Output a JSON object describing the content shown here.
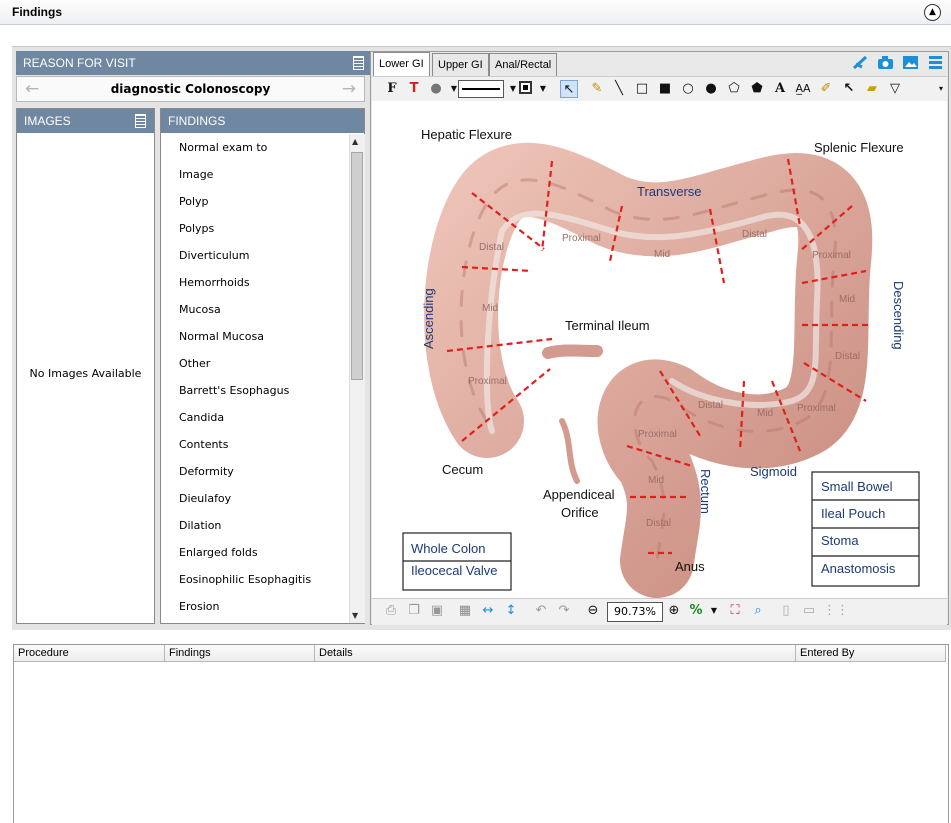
{
  "window": {
    "title": "Findings"
  },
  "reason_for_visit": {
    "header": "REASON FOR VISIT",
    "value": "diagnostic Colonoscopy"
  },
  "images": {
    "header": "IMAGES",
    "empty_text": "No Images Available"
  },
  "findings": {
    "header": "FINDINGS",
    "items": [
      "Normal exam to",
      "Image",
      "Polyp",
      "Polyps",
      "Diverticulum",
      "Hemorrhoids",
      "Mucosa",
      "Normal Mucosa",
      "Other",
      "Barrett's Esophagus",
      "Candida",
      "Contents",
      "Deformity",
      "Dieulafoy",
      "Dilation",
      "Enlarged folds",
      "Eosinophilic Esophagitis",
      "Erosion"
    ]
  },
  "tabs": [
    {
      "label": "Lower GI",
      "active": true
    },
    {
      "label": "Upper GI"
    },
    {
      "label": "Anal/Rectal"
    }
  ],
  "toolbar": {
    "zoom": "90.73%"
  },
  "diagram": {
    "labels": {
      "hepatic": "Hepatic Flexure",
      "splenic": "Splenic Flexure",
      "transverse": "Transverse",
      "ascending": "Ascending",
      "descending": "Descending",
      "terminal_ileum": "Terminal Ileum",
      "cecum": "Cecum",
      "appendiceal": "Appendiceal",
      "orifice": "Orifice",
      "anus": "Anus",
      "rectum": "Rectum",
      "sigmoid": "Sigmoid"
    },
    "segments": {
      "t_prox": "Proximal",
      "t_mid": "Mid",
      "t_dist": "Distal",
      "a_dist": "Distal",
      "a_mid": "Mid",
      "a_prox": "Proximal",
      "d_prox": "Proximal",
      "d_mid": "Mid",
      "d_dist": "Distal",
      "s_dist": "Distal",
      "s_mid": "Mid",
      "s_prox": "Proximal",
      "r_prox": "Proximal",
      "r_mid": "Mid",
      "r_dist": "Distal"
    },
    "left_buttons": [
      "Whole Colon",
      "Ileocecal Valve"
    ],
    "right_buttons": [
      "Small Bowel",
      "Ileal Pouch",
      "Stoma",
      "Anastomosis"
    ]
  },
  "grid": {
    "columns": [
      "Procedure",
      "Findings",
      "Details",
      "Entered By"
    ]
  },
  "colors": {
    "panel_header": "#6f87a1",
    "colon": "#dba79c",
    "dash": "#e0201c",
    "label_blue": "#1c3a78"
  }
}
